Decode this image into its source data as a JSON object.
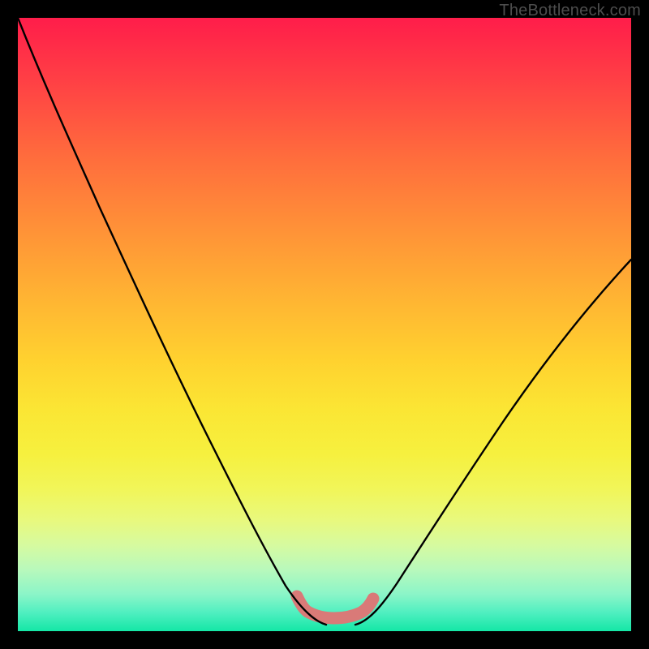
{
  "attribution": "TheBottleneck.com",
  "colors": {
    "frame": "#000000",
    "gradient_top": "#ff1d4a",
    "gradient_bottom": "#14e7a6",
    "curve_black": "#000000",
    "trough_pink": "#d97a78"
  },
  "chart_data": {
    "type": "line",
    "title": "",
    "xlabel": "",
    "ylabel": "",
    "xlim": [
      0,
      1
    ],
    "ylim": [
      0,
      1
    ],
    "notes": "Heat-gradient background (red=high bottleneck near top, green=low near bottom). Two black curves descend from upper corners to a shared trough; a thick salmon-pink segment highlights the minimum zone around x≈0.46–0.58, y≈0.02–0.05.",
    "series": [
      {
        "name": "left-curve",
        "x": [
          0.0,
          0.06,
          0.12,
          0.18,
          0.24,
          0.3,
          0.36,
          0.4,
          0.44,
          0.47,
          0.5
        ],
        "y": [
          1.0,
          0.86,
          0.73,
          0.6,
          0.47,
          0.35,
          0.23,
          0.15,
          0.08,
          0.04,
          0.02
        ]
      },
      {
        "name": "right-curve",
        "x": [
          0.55,
          0.6,
          0.66,
          0.72,
          0.78,
          0.84,
          0.9,
          0.96,
          1.0
        ],
        "y": [
          0.02,
          0.06,
          0.13,
          0.21,
          0.3,
          0.39,
          0.48,
          0.56,
          0.61
        ]
      },
      {
        "name": "trough-highlight",
        "x": [
          0.455,
          0.475,
          0.5,
          0.535,
          0.56,
          0.58
        ],
        "y": [
          0.055,
          0.03,
          0.02,
          0.02,
          0.03,
          0.05
        ]
      }
    ]
  }
}
